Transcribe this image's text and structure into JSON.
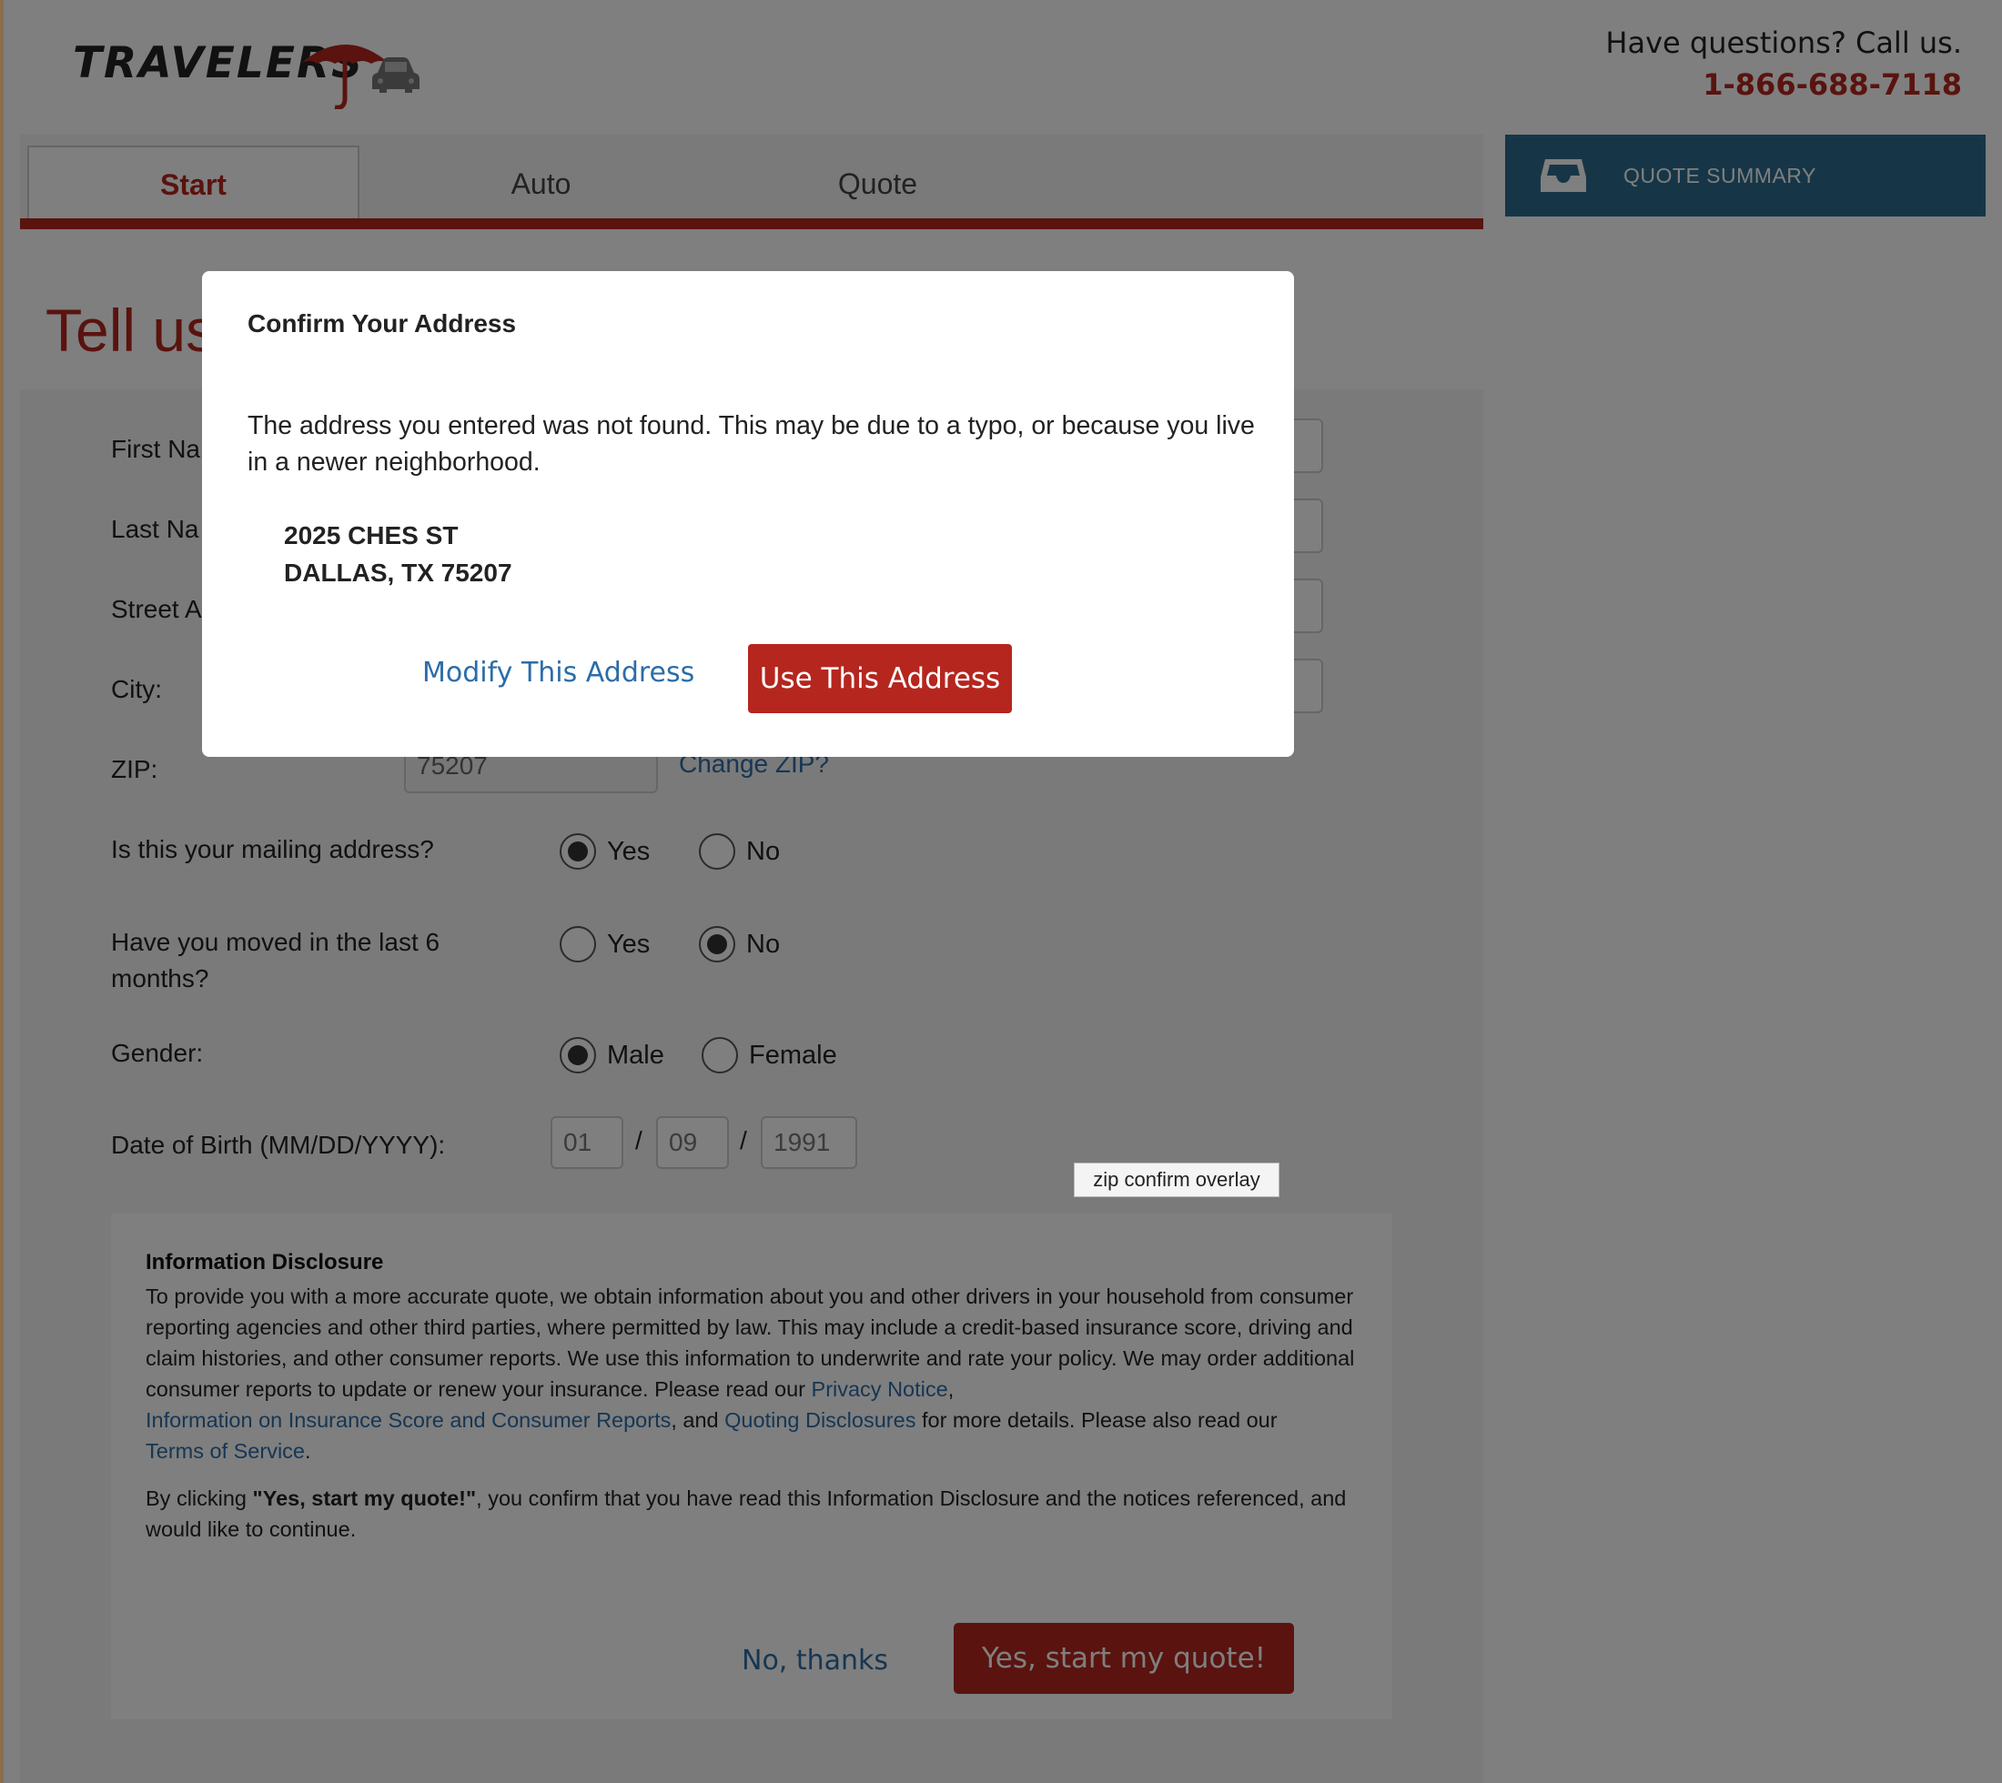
{
  "header": {
    "brand": "TRAVELERS",
    "contact_question": "Have questions? Call us.",
    "phone": "1-866-688-7118"
  },
  "tabs": [
    {
      "label": "Start",
      "active": true
    },
    {
      "label": "Auto",
      "active": false
    },
    {
      "label": "Quote",
      "active": false
    }
  ],
  "quote_summary": {
    "label": "QUOTE SUMMARY",
    "icon": "inbox-icon"
  },
  "page_title": "Tell us",
  "form": {
    "first_name_label": "First Na",
    "last_name_label": "Last Na",
    "street_label": "Street A",
    "city_label": "City:",
    "zip_label": "ZIP:",
    "zip_value": "75207",
    "change_zip": "Change ZIP?",
    "mailing_question": "Is this your mailing address?",
    "mailing_options": [
      "Yes",
      "No"
    ],
    "mailing_selected": "Yes",
    "moved_question": "Have you moved in the last 6 months?",
    "moved_options": [
      "Yes",
      "No"
    ],
    "moved_selected": "No",
    "gender_label": "Gender:",
    "gender_options": [
      "Male",
      "Female"
    ],
    "gender_selected": "Male",
    "dob_label": "Date of Birth (MM/DD/YYYY):",
    "dob_month": "01",
    "dob_day": "09",
    "dob_year": "1991",
    "dob_separator": "/"
  },
  "tooltip": "zip confirm overlay",
  "disclosure": {
    "title": "Information Disclosure",
    "body_start": "To provide you with a more accurate quote, we obtain information about you and other drivers in your household from consumer reporting agencies and other third parties, where permitted by law. This may include a credit-based insurance score, driving and claim histories, and other consumer reports. We use this information to underwrite and rate your policy. We may order additional consumer reports to update or renew your insurance. Please read our ",
    "privacy_link": "Privacy Notice",
    "comma": ",",
    "insurance_score_link": "Information on Insurance Score and Consumer Reports",
    "and_text": ", and ",
    "quoting_link": "Quoting Disclosures",
    "after_quoting": " for more details. Please also read our",
    "terms_link": "Terms of Service",
    "period": ".",
    "confirm_prefix": "By clicking ",
    "confirm_bold": "\"Yes, start my quote!\"",
    "confirm_suffix": ", you confirm that you have read this Information Disclosure and the notices referenced, and would like to continue.",
    "no_thanks": "No, thanks",
    "start_button": "Yes, start my quote!"
  },
  "modal": {
    "title": "Confirm Your Address",
    "message": "The address you entered was not found. This may be due to a typo, or because you live in a newer neighborhood.",
    "address_line1": "2025 CHES ST",
    "address_line2": "DALLAS, TX 75207",
    "modify_label": "Modify This Address",
    "use_label": "Use This Address"
  },
  "colors": {
    "brand_red": "#b5261e",
    "link_blue": "#2c6da8",
    "summary_blue": "#2c6d8e"
  }
}
